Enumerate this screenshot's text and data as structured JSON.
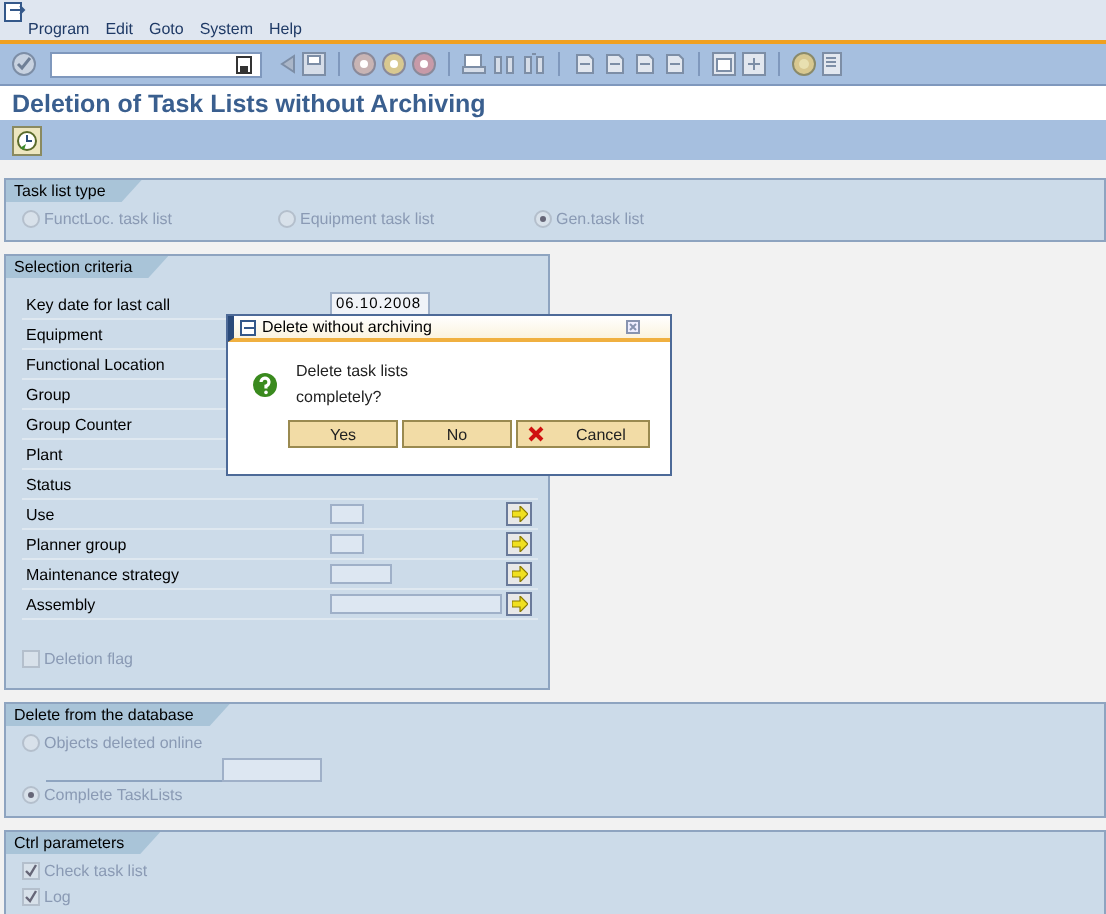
{
  "menu": [
    {
      "label": "Program"
    },
    {
      "label": "Edit"
    },
    {
      "label": "Goto"
    },
    {
      "label": "System"
    },
    {
      "label": "Help"
    }
  ],
  "title": "Deletion of Task Lists without Archiving",
  "task_list_type": {
    "title": "Task list type",
    "options": [
      {
        "label": "FunctLoc. task list",
        "selected": false,
        "disabled": true
      },
      {
        "label": "Equipment task list",
        "selected": false,
        "disabled": true
      },
      {
        "label": "Gen.task list",
        "selected": true,
        "disabled": true
      }
    ]
  },
  "selection_criteria": {
    "title": "Selection criteria",
    "rows": [
      {
        "label": "Key date for last call",
        "kind": "date",
        "value": "06.10.2008"
      },
      {
        "label": "Equipment",
        "kind": "covered"
      },
      {
        "label": "Functional Location",
        "kind": "covered"
      },
      {
        "label": "Group",
        "kind": "covered"
      },
      {
        "label": "Group Counter",
        "kind": "covered"
      },
      {
        "label": "Plant",
        "kind": "covered"
      },
      {
        "label": "Status",
        "kind": "covered"
      },
      {
        "label": "Use",
        "kind": "short",
        "more": true
      },
      {
        "label": "Planner group",
        "kind": "short",
        "more": true
      },
      {
        "label": "Maintenance strategy",
        "kind": "medium",
        "more": true
      },
      {
        "label": "Assembly",
        "kind": "long",
        "more": true
      }
    ],
    "deletion_flag": {
      "label": "Deletion flag",
      "checked": false,
      "disabled": true
    }
  },
  "delete_from_database": {
    "title": "Delete from the database",
    "options": [
      {
        "label": "Objects deleted online",
        "selected": false,
        "disabled": true
      },
      {
        "label": "Complete TaskLists",
        "selected": true,
        "disabled": true
      }
    ]
  },
  "ctrl_parameters": {
    "title": "Ctrl parameters",
    "checkboxes": [
      {
        "label": "Check task list",
        "checked": true,
        "disabled": true
      },
      {
        "label": "Log",
        "checked": true,
        "disabled": true
      }
    ]
  },
  "dialog": {
    "title": "Delete without archiving",
    "message": "Delete task lists completely?",
    "buttons": [
      {
        "label": "Yes",
        "kind": "plain"
      },
      {
        "label": "No",
        "kind": "plain"
      },
      {
        "label": "Cancel",
        "kind": "cancel"
      }
    ]
  }
}
